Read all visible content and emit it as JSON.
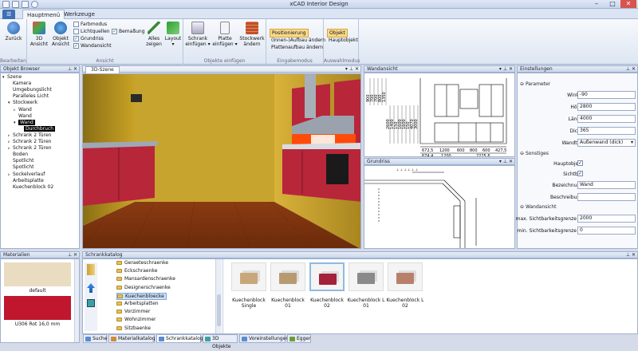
{
  "app": {
    "title": "xCAD Interior Design"
  },
  "window_controls": {
    "minimize": "–",
    "maximize": "□",
    "close": "✕"
  },
  "ribbon_tabs": [
    {
      "label": "Hauptmenü",
      "active": true
    },
    {
      "label": "Werkzeuge",
      "active": false
    }
  ],
  "ribbon": {
    "groups": {
      "bearbeiten": {
        "label": "Bearbeiten",
        "zurueck": "Zurück"
      },
      "ansicht": {
        "label": "Ansicht",
        "ansicht_3d": "3D Ansicht",
        "objekt_ansicht": "Objekt Ansicht",
        "checks": [
          {
            "label": "Farbmodus",
            "checked": false
          },
          {
            "label": "Lichtquellen",
            "checked": false
          },
          {
            "label": "Grundriss",
            "checked": true
          },
          {
            "label": "Wandansicht",
            "checked": true
          },
          {
            "label": "Bemaßung",
            "checked": true
          }
        ],
        "alles_zeigen": "Alles zeigen",
        "layout": "Layout"
      },
      "objekte_einfuegen": {
        "label": "Objekte einfügen",
        "schrank": "Schrank einfügen",
        "platte": "Platte einfügen",
        "stockwerk": "Stockwerk ändern"
      },
      "eingabemodus": {
        "label": "Eingabemodus",
        "items": [
          {
            "label": "Positionierung",
            "active": true
          },
          {
            "label": "(Innen-)Aufbau ändern",
            "active": false
          },
          {
            "label": "Plattenaufbau ändern",
            "active": false
          }
        ]
      },
      "auswahlmodus": {
        "label": "Auswahlmodus",
        "items": [
          {
            "label": "Objekt",
            "active": true
          },
          {
            "label": "Hauptobjekt",
            "active": false
          }
        ]
      }
    }
  },
  "objekt_browser": {
    "title": "Objekt Browser",
    "tree": [
      {
        "label": "Szene",
        "level": 0,
        "expander": "▾"
      },
      {
        "label": "Kamera",
        "level": 1,
        "expander": ""
      },
      {
        "label": "Umgebungslicht",
        "level": 1,
        "expander": ""
      },
      {
        "label": "Paralleles Licht",
        "level": 1,
        "expander": ""
      },
      {
        "label": "Stockwerk",
        "level": 1,
        "expander": "▾"
      },
      {
        "label": "Wand",
        "level": 2,
        "expander": "▹"
      },
      {
        "label": "Wand",
        "level": 2,
        "expander": ""
      },
      {
        "label": "Wand",
        "level": 2,
        "expander": "▾",
        "selected": true
      },
      {
        "label": "Durchbruch",
        "level": 3,
        "expander": "",
        "selected": true
      },
      {
        "label": "Schrank 2 Türen",
        "level": 1,
        "expander": "▹"
      },
      {
        "label": "Schrank 2 Türen",
        "level": 1,
        "expander": "▹"
      },
      {
        "label": "Schrank 2 Türen",
        "level": 1,
        "expander": "▹"
      },
      {
        "label": "Boden",
        "level": 1,
        "expander": ""
      },
      {
        "label": "Spotlicht",
        "level": 1,
        "expander": ""
      },
      {
        "label": "Spotlicht",
        "level": 1,
        "expander": ""
      },
      {
        "label": "Sockelverlauf",
        "level": 1,
        "expander": "▹"
      },
      {
        "label": "Arbeitsplatte",
        "level": 1,
        "expander": ""
      },
      {
        "label": "Kuechenblock 02",
        "level": 1,
        "expander": ""
      }
    ]
  },
  "szene3d": {
    "title": "3D-Szene"
  },
  "wandansicht": {
    "title": "Wandansicht",
    "vertical_dims": [
      "900",
      "700",
      "700",
      "800",
      "1350",
      "2600",
      "1400",
      "150",
      "1600",
      "1600",
      "150",
      "4070",
      "3000"
    ],
    "bottom_dims_row1": [
      "672,5",
      "1200",
      "600",
      "800",
      "600",
      "427,5"
    ],
    "bottom_dims_row2": [
      "674,4",
      "1200",
      "2225,6"
    ]
  },
  "grundriss": {
    "title": "Grundriss"
  },
  "einstellungen": {
    "title": "Einstellungen",
    "parameter": {
      "section": "Parameter",
      "rows": [
        {
          "label": "Winkel",
          "value": "-90"
        },
        {
          "label": "Höhe",
          "value": "2800"
        },
        {
          "label": "Länge",
          "value": "4000"
        },
        {
          "label": "Dicke",
          "value": "365"
        },
        {
          "label": "Wandtyp",
          "value": "Außenwand (dick)"
        }
      ]
    },
    "sonstiges": {
      "section": "Sonstiges",
      "hauptobjekt": {
        "label": "Hauptobjekt",
        "checked": true
      },
      "sichtbar": {
        "label": "Sichtbar",
        "checked": true
      },
      "bezeichnung": {
        "label": "Bezeichnung",
        "value": "Wand"
      },
      "beschreibung": {
        "label": "Beschreibung",
        "value": ""
      }
    },
    "wandansicht": {
      "section": "Wandansicht",
      "max": {
        "label": "max. Sichtbarkeitsgrenze",
        "value": "2000"
      },
      "min": {
        "label": "min. Sichtbarkeitsgrenze",
        "value": "0"
      }
    }
  },
  "materialien": {
    "title": "Materialien",
    "items": [
      {
        "label": "default",
        "color": "#e9dcc0"
      },
      {
        "label": "U306 Rot 16,0 mm",
        "color": "#c0172e"
      }
    ]
  },
  "schrankkatalog": {
    "title": "Schrankkatalog",
    "categories": [
      {
        "label": "Geraeteschraenke",
        "selected": false
      },
      {
        "label": "Eckschraenke",
        "selected": false
      },
      {
        "label": "Mansardenschraenke",
        "selected": false
      },
      {
        "label": "Designerschraenke",
        "selected": false
      },
      {
        "label": "Kuechenbloecke",
        "selected": true
      },
      {
        "label": "Arbeitsplatten",
        "selected": false
      },
      {
        "label": "Vorzimmer",
        "selected": false
      },
      {
        "label": "Wohnzimmer",
        "selected": false
      },
      {
        "label": "Sitzbaenke",
        "selected": false
      }
    ],
    "items": [
      {
        "label": "Kuechenblock Single",
        "color": "#c9a77a",
        "selected": false
      },
      {
        "label": "Kuechenblock 01",
        "color": "#b89a72",
        "selected": false
      },
      {
        "label": "Kuechenblock 02",
        "color": "#a3213a",
        "selected": true
      },
      {
        "label": "Kuechenblock L 01",
        "color": "#8a8a8a",
        "selected": false
      },
      {
        "label": "Kuechenblock L 02",
        "color": "#b8806a",
        "selected": false
      }
    ]
  },
  "bottom_tabs": [
    {
      "label": "Suche",
      "color": "#5b8bd0",
      "active": false
    },
    {
      "label": "Materialkatalog",
      "color": "#d08b3a",
      "active": false
    },
    {
      "label": "Schrankkatalog",
      "color": "#5b8bd0",
      "active": true
    },
    {
      "label": "3D Objekte",
      "color": "#3aa0a0",
      "active": false
    },
    {
      "label": "Voreinstellungen",
      "color": "#5b8bd0",
      "active": false
    },
    {
      "label": "Egger",
      "color": "#6b9d3a",
      "active": false
    }
  ]
}
